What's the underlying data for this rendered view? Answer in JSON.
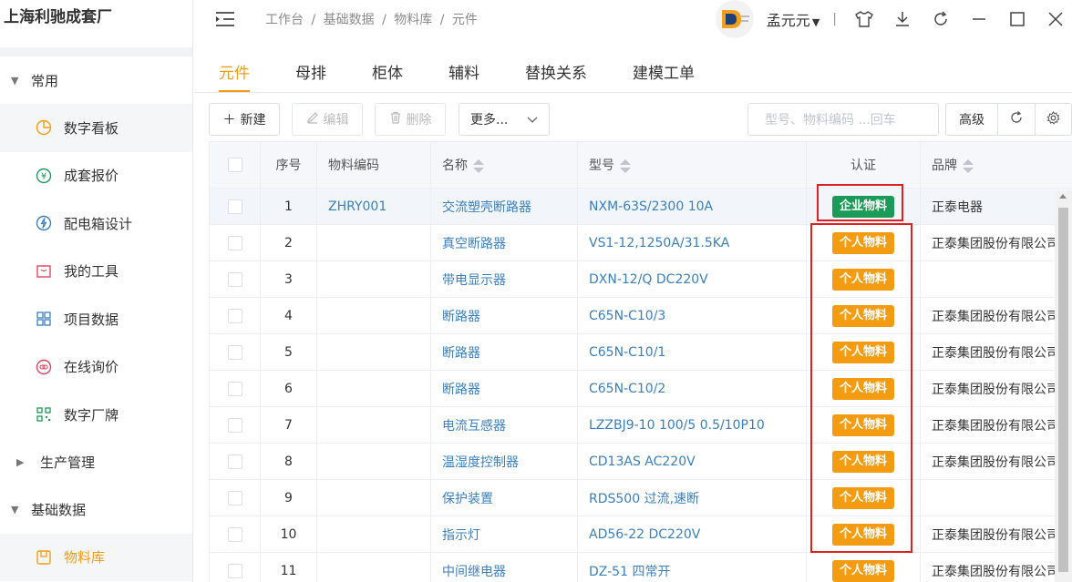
{
  "app": {
    "brand": "上海利驰成套厂"
  },
  "sidebar": {
    "groups": [
      {
        "label": "常用",
        "expanded": true
      },
      {
        "label": "生产管理",
        "expanded": false
      },
      {
        "label": "基础数据",
        "expanded": true
      }
    ],
    "items": [
      {
        "label": "数字看板",
        "icon": "pie-chart-icon"
      },
      {
        "label": "成套报价",
        "icon": "yen-coin-icon"
      },
      {
        "label": "配电箱设计",
        "icon": "lightning-icon"
      },
      {
        "label": "我的工具",
        "icon": "toolbox-icon"
      },
      {
        "label": "项目数据",
        "icon": "grid-icon"
      },
      {
        "label": "在线询价",
        "icon": "link-icon"
      },
      {
        "label": "数字厂牌",
        "icon": "qrcode-icon"
      },
      {
        "label": "物料库",
        "icon": "box-icon",
        "active": true
      }
    ]
  },
  "header": {
    "breadcrumb": [
      "工作台",
      "基础数据",
      "物料库",
      "元件"
    ],
    "separator": "/",
    "username": "孟元元",
    "divider": "|"
  },
  "tabs": [
    {
      "label": "元件",
      "active": true
    },
    {
      "label": "母排"
    },
    {
      "label": "柜体"
    },
    {
      "label": "辅料"
    },
    {
      "label": "替换关系"
    },
    {
      "label": "建模工单"
    }
  ],
  "toolbar": {
    "new_label": "新建",
    "edit_label": "编辑",
    "delete_label": "删除",
    "more_label": "更多...",
    "search_placeholder": "型号、物料编码 ...回车",
    "advanced_label": "高级"
  },
  "table": {
    "columns": {
      "index": "序号",
      "code": "物料编码",
      "name": "名称",
      "model": "型号",
      "cert": "认证",
      "brand": "品牌"
    },
    "rows": [
      {
        "index": "1",
        "code": "ZHRY001",
        "name": "交流塑壳断路器",
        "model": "NXM-63S/2300 10A",
        "cert": "企业物料",
        "cert_color": "#1a9c58",
        "brand": "正泰电器"
      },
      {
        "index": "2",
        "code": "",
        "name": "真空断路器",
        "model": "VS1-12,1250A/31.5KA",
        "cert": "个人物料",
        "cert_color": "#f39c12",
        "brand": "正泰集团股份有限公司"
      },
      {
        "index": "3",
        "code": "",
        "name": "带电显示器",
        "model": "DXN-12/Q DC220V",
        "cert": "个人物料",
        "cert_color": "#f39c12",
        "brand": ""
      },
      {
        "index": "4",
        "code": "",
        "name": "断路器",
        "model": "C65N-C10/3",
        "cert": "个人物料",
        "cert_color": "#f39c12",
        "brand": "正泰集团股份有限公司"
      },
      {
        "index": "5",
        "code": "",
        "name": "断路器",
        "model": "C65N-C10/1",
        "cert": "个人物料",
        "cert_color": "#f39c12",
        "brand": "正泰集团股份有限公司"
      },
      {
        "index": "6",
        "code": "",
        "name": "断路器",
        "model": "C65N-C10/2",
        "cert": "个人物料",
        "cert_color": "#f39c12",
        "brand": "正泰集团股份有限公司"
      },
      {
        "index": "7",
        "code": "",
        "name": "电流互感器",
        "model": "LZZBJ9-10 100/5 0.5/10P10",
        "cert": "个人物料",
        "cert_color": "#f39c12",
        "brand": "正泰集团股份有限公司"
      },
      {
        "index": "8",
        "code": "",
        "name": "温湿度控制器",
        "model": "CD13AS AC220V",
        "cert": "个人物料",
        "cert_color": "#f39c12",
        "brand": "正泰集团股份有限公司"
      },
      {
        "index": "9",
        "code": "",
        "name": "保护装置",
        "model": "RDS500 过流,速断",
        "cert": "个人物料",
        "cert_color": "#f39c12",
        "brand": ""
      },
      {
        "index": "10",
        "code": "",
        "name": "指示灯",
        "model": "AD56-22 DC220V",
        "cert": "个人物料",
        "cert_color": "#f39c12",
        "brand": "正泰集团股份有限公司"
      },
      {
        "index": "11",
        "code": "",
        "name": "中间继电器",
        "model": "DZ-51 四常开",
        "cert": "个人物料",
        "cert_color": "#f39c12",
        "brand": "正泰集团股份有限公司"
      }
    ]
  },
  "colors": {
    "accent": "#f39c12",
    "link": "#3a7fbf",
    "enterprise_tag": "#1a9c58",
    "personal_tag": "#f39c12",
    "highlight_box": "#e0201e"
  }
}
